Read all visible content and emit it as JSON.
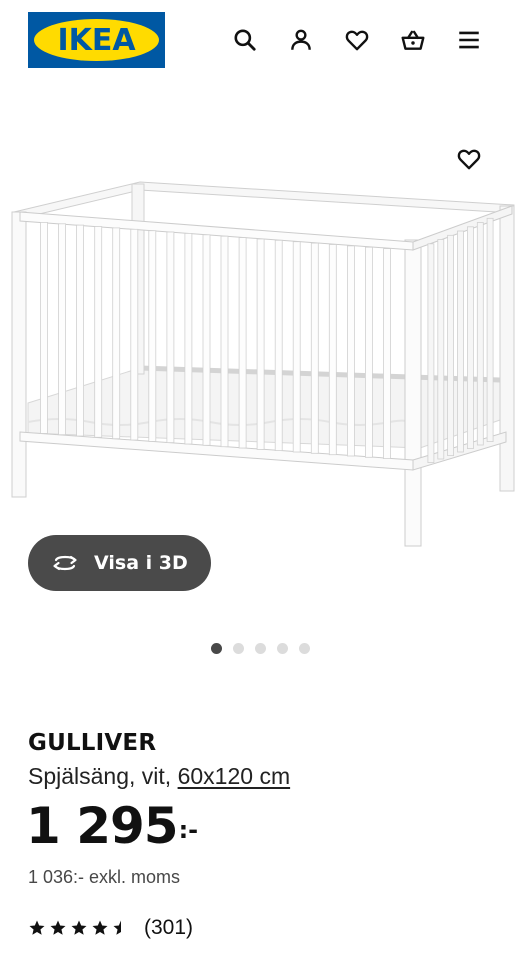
{
  "header": {
    "logo_text": "IKEA",
    "icons": [
      "search-icon",
      "account-icon",
      "favourites-icon",
      "basket-icon",
      "menu-icon"
    ]
  },
  "gallery": {
    "view_3d_label": "Visa i 3D",
    "image_count": 5,
    "active_index": 0
  },
  "product": {
    "name": "GULLIVER",
    "description": "Spjälsäng, vit, ",
    "size_link": "60x120 cm",
    "price": "1 295",
    "price_suffix": ":-",
    "price_excl": "1 036:- exkl. moms",
    "rating_value": 4.5,
    "rating_max": 5,
    "review_count": "(301)"
  },
  "colors": {
    "ikea_blue": "#0058a3",
    "ikea_yellow": "#ffdb00",
    "button_dark": "#4a4a4a"
  }
}
